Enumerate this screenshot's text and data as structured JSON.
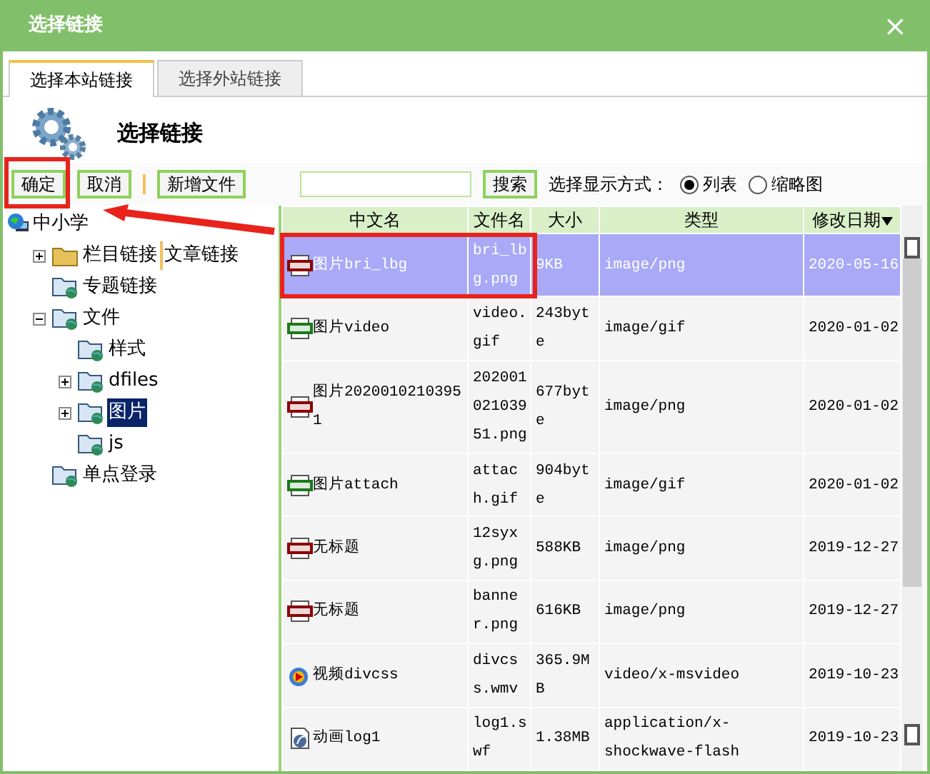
{
  "window": {
    "title": "选择链接",
    "close": "×"
  },
  "tabs": [
    {
      "label": "选择本站链接",
      "selected": true
    },
    {
      "label": "选择外站链接",
      "selected": false
    }
  ],
  "header": {
    "title": "选择链接"
  },
  "toolbar": {
    "buttons": [
      "确定",
      "取消",
      "新增文件"
    ],
    "search_button": "搜索",
    "view_label": "选择显示方式：",
    "view_modes": [
      {
        "label": "列表",
        "selected": true
      },
      {
        "label": "缩略图",
        "selected": false
      }
    ]
  },
  "tree": [
    {
      "label": "中小学",
      "kind": "site",
      "selected": false,
      "children": [
        {
          "label": "栏目链接",
          "extra": "文章链接",
          "kind": "folder",
          "expanded": false,
          "selected": false
        },
        {
          "label": "专题链接",
          "kind": "web-folder",
          "selected": false
        },
        {
          "label": "文件",
          "kind": "web-folder",
          "expanded": true,
          "selected": false,
          "children": [
            {
              "label": "样式",
              "kind": "web-folder",
              "selected": false
            },
            {
              "label": "dfiles",
              "kind": "web-folder",
              "expanded": false,
              "selected": false
            },
            {
              "label": "图片",
              "kind": "web-folder",
              "expanded": false,
              "selected": true
            },
            {
              "label": "js",
              "kind": "web-folder",
              "selected": false
            }
          ]
        },
        {
          "label": "单点登录",
          "kind": "web-folder",
          "selected": false
        }
      ]
    }
  ],
  "table": {
    "columns": [
      {
        "label": "中文名",
        "sorted": false
      },
      {
        "label": "文件名",
        "sorted": false
      },
      {
        "label": "大小",
        "sorted": false
      },
      {
        "label": "类型",
        "sorted": false
      },
      {
        "label": "修改日期",
        "sorted": true
      }
    ],
    "rows": [
      {
        "kind": "png",
        "name": "图片bri_lbg",
        "file": "bri_lbg.png",
        "size": "9KB",
        "type": "image/png",
        "date": "2020-05-16",
        "selected": true
      },
      {
        "kind": "gif",
        "name": "图片video",
        "file": "video.gif",
        "size": "243byte",
        "type": "image/gif",
        "date": "2020-01-02",
        "selected": false
      },
      {
        "kind": "png",
        "name": "图片20200102103951",
        "file": "20200102103951.png",
        "size": "677byte",
        "type": "image/png",
        "date": "2020-01-02",
        "selected": false
      },
      {
        "kind": "gif",
        "name": "图片attach",
        "file": "attach.gif",
        "size": "904byte",
        "type": "image/gif",
        "date": "2020-01-02",
        "selected": false
      },
      {
        "kind": "png",
        "name": "无标题",
        "file": "12syxg.png",
        "size": "588KB",
        "type": "image/png",
        "date": "2019-12-27",
        "selected": false
      },
      {
        "kind": "png",
        "name": "无标题",
        "file": "banner.png",
        "size": "616KB",
        "type": "image/png",
        "date": "2019-12-27",
        "selected": false
      },
      {
        "kind": "video",
        "name": "视频divcss",
        "file": "divcss.wmv",
        "size": "365.9MB",
        "type": "video/x-msvideo",
        "date": "2019-10-23",
        "selected": false
      },
      {
        "kind": "flash",
        "name": "动画log1",
        "file": "log1.swf",
        "size": "1.38MB",
        "type": "application/x-shockwave-flash",
        "date": "2019-10-23",
        "selected": false
      }
    ]
  }
}
